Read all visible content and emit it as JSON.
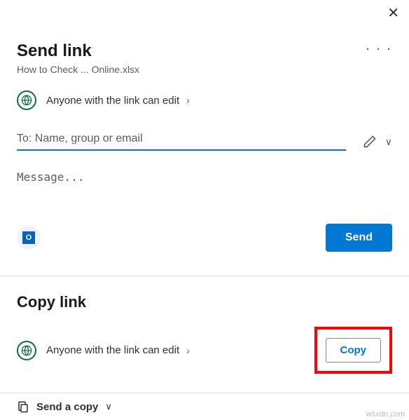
{
  "header": {
    "title": "Send link",
    "filename": "How to Check ... Online.xlsx"
  },
  "permission": {
    "text": "Anyone with the link can edit"
  },
  "to": {
    "placeholder": "To: Name, group or email",
    "value": ""
  },
  "message": {
    "placeholder": "Message...",
    "value": ""
  },
  "buttons": {
    "send": "Send",
    "copy": "Copy"
  },
  "copylink": {
    "title": "Copy link",
    "permission_text": "Anyone with the link can edit"
  },
  "footer": {
    "send_copy": "Send a copy"
  },
  "watermark": "wsxdn.com"
}
